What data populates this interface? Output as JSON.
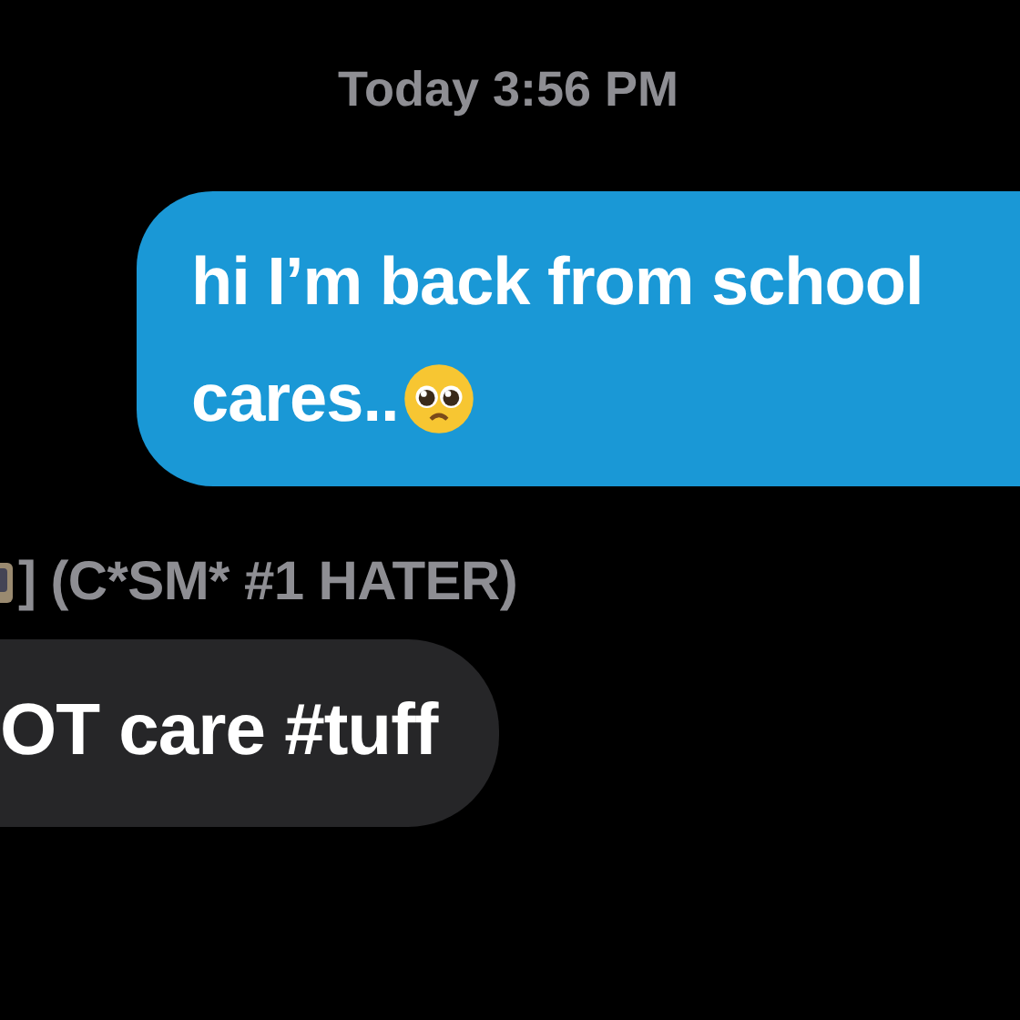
{
  "timestamp": "Today 3:56 PM",
  "messages": [
    {
      "kind": "sent",
      "lines": [
        "hi I’m back from school",
        "cares.."
      ],
      "emoji_after": true
    },
    {
      "kind": "received",
      "sender": "] (C*SM* #1 HATER)",
      "lines": [
        "OT care #tuff"
      ],
      "emoji_after": false
    }
  ]
}
